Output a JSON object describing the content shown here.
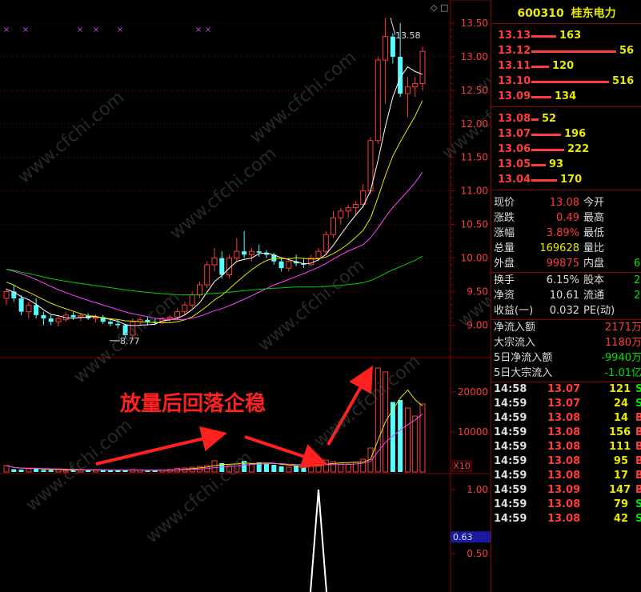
{
  "stock": {
    "code": "600310",
    "name": "桂东电力"
  },
  "price_axis": [
    "13.50",
    "13.00",
    "12.50",
    "12.00",
    "11.50",
    "11.00",
    "10.50",
    "10.00",
    "9.50",
    "9.00"
  ],
  "volume_axis": [
    "20000",
    "10000"
  ],
  "volume_unit": "X10",
  "indicator_axis": [
    "1.00",
    "0.50"
  ],
  "indicator_value": "0.63",
  "annotations": {
    "high": "13.58",
    "low": "8.77",
    "note": "放量后回落企稳"
  },
  "watermark": "www.cfchi.com",
  "order_book": {
    "asks": [
      {
        "price": "13.13",
        "vol": "163",
        "bar": 0.26
      },
      {
        "price": "13.12",
        "vol": "56",
        "bar": 0.9
      },
      {
        "price": "13.11",
        "vol": "120",
        "bar": 0.19
      },
      {
        "price": "13.10",
        "vol": "516",
        "bar": 0.82
      },
      {
        "price": "13.09",
        "vol": "134",
        "bar": 0.21
      }
    ],
    "bids": [
      {
        "price": "13.08",
        "vol": "52",
        "bar": 0.08
      },
      {
        "price": "13.07",
        "vol": "196",
        "bar": 0.31
      },
      {
        "price": "13.06",
        "vol": "222",
        "bar": 0.35
      },
      {
        "price": "13.05",
        "vol": "93",
        "bar": 0.15
      },
      {
        "price": "13.04",
        "vol": "170",
        "bar": 0.27
      }
    ]
  },
  "quote": {
    "rows": [
      {
        "l1": "现价",
        "v1": "13.08",
        "c1": "red",
        "l2": "今开",
        "v2": ""
      },
      {
        "l1": "涨跌",
        "v1": "0.49",
        "c1": "red",
        "l2": "最高",
        "v2": ""
      },
      {
        "l1": "涨幅",
        "v1": "3.89%",
        "c1": "red",
        "l2": "最低",
        "v2": ""
      },
      {
        "l1": "总量",
        "v1": "169628",
        "c1": "yellow",
        "l2": "量比",
        "v2": ""
      },
      {
        "l1": "外盘",
        "v1": "99875",
        "c1": "red",
        "l2": "内盘",
        "v2": "6"
      }
    ],
    "rows2": [
      {
        "l1": "换手",
        "v1": "6.15%",
        "c1": "white",
        "l2": "股本",
        "v2": "2"
      },
      {
        "l1": "净资",
        "v1": "10.61",
        "c1": "white",
        "l2": "流通",
        "v2": "2"
      },
      {
        "l1": "收益(一)",
        "v1": "0.032",
        "c1": "white",
        "l2": "PE(动)",
        "v2": ""
      }
    ],
    "flows": [
      {
        "label": "净流入额",
        "value": "2171万",
        "color": "red"
      },
      {
        "label": "大宗流入",
        "value": "1180万",
        "color": "red"
      },
      {
        "label": "5日净流入额",
        "value": "-9940万",
        "color": "green"
      },
      {
        "label": "5日大宗流入",
        "value": "-1.01亿",
        "color": "green"
      }
    ]
  },
  "trades": [
    {
      "time": "14:58",
      "price": "13.07",
      "vol": "121",
      "side": "S"
    },
    {
      "time": "14:59",
      "price": "13.07",
      "vol": "24",
      "side": "S"
    },
    {
      "time": "14:59",
      "price": "13.08",
      "vol": "14",
      "side": "B"
    },
    {
      "time": "14:59",
      "price": "13.08",
      "vol": "156",
      "side": "B"
    },
    {
      "time": "14:59",
      "price": "13.08",
      "vol": "111",
      "side": "B"
    },
    {
      "time": "14:59",
      "price": "13.08",
      "vol": "95",
      "side": "B"
    },
    {
      "time": "14:59",
      "price": "13.08",
      "vol": "17",
      "side": "B"
    },
    {
      "time": "14:59",
      "price": "13.09",
      "vol": "147",
      "side": "B"
    },
    {
      "time": "14:59",
      "price": "13.08",
      "vol": "79",
      "side": "S"
    },
    {
      "time": "14:59",
      "price": "13.08",
      "vol": "42",
      "side": "S"
    }
  ],
  "chart_data": {
    "type": "candlestick",
    "candles": [
      [
        9.4,
        9.55,
        9.3,
        9.5
      ],
      [
        9.5,
        9.6,
        9.35,
        9.4
      ],
      [
        9.4,
        9.45,
        9.15,
        9.2
      ],
      [
        9.2,
        9.35,
        9.1,
        9.3
      ],
      [
        9.3,
        9.4,
        9.1,
        9.15
      ],
      [
        9.15,
        9.2,
        9.0,
        9.1
      ],
      [
        9.1,
        9.15,
        9.0,
        9.05
      ],
      [
        9.05,
        9.15,
        8.98,
        9.1
      ],
      [
        9.08,
        9.2,
        9.05,
        9.15
      ],
      [
        9.15,
        9.2,
        9.08,
        9.12
      ],
      [
        9.12,
        9.18,
        9.06,
        9.14
      ],
      [
        9.14,
        9.18,
        9.08,
        9.1
      ],
      [
        9.1,
        9.16,
        9.04,
        9.12
      ],
      [
        9.12,
        9.15,
        9.02,
        9.05
      ],
      [
        9.05,
        9.1,
        8.98,
        9.02
      ],
      [
        9.02,
        9.08,
        8.95,
        9.0
      ],
      [
        9.0,
        9.02,
        8.8,
        8.85
      ],
      [
        8.85,
        9.1,
        8.77,
        9.05
      ],
      [
        9.05,
        9.12,
        9.0,
        9.08
      ],
      [
        9.08,
        9.12,
        9.0,
        9.05
      ],
      [
        9.05,
        9.1,
        9.0,
        9.04
      ],
      [
        9.04,
        9.12,
        9.02,
        9.1
      ],
      [
        9.1,
        9.15,
        9.05,
        9.12
      ],
      [
        9.12,
        9.25,
        9.08,
        9.2
      ],
      [
        9.2,
        9.35,
        9.15,
        9.3
      ],
      [
        9.3,
        9.5,
        9.25,
        9.45
      ],
      [
        9.45,
        9.65,
        9.4,
        9.6
      ],
      [
        9.6,
        9.95,
        9.55,
        9.9
      ],
      [
        9.9,
        10.15,
        9.8,
        10.0
      ],
      [
        10.0,
        10.1,
        9.7,
        9.75
      ],
      [
        9.75,
        10.05,
        9.7,
        10.0
      ],
      [
        10.0,
        10.3,
        9.95,
        10.1
      ],
      [
        10.1,
        10.4,
        10.0,
        10.05
      ],
      [
        10.05,
        10.15,
        9.95,
        10.1
      ],
      [
        10.1,
        10.2,
        10.02,
        10.08
      ],
      [
        10.08,
        10.12,
        10.0,
        10.05
      ],
      [
        10.05,
        10.08,
        9.9,
        9.95
      ],
      [
        9.95,
        10.0,
        9.8,
        9.85
      ],
      [
        9.85,
        10.0,
        9.8,
        9.95
      ],
      [
        9.95,
        10.05,
        9.88,
        9.92
      ],
      [
        9.92,
        10.0,
        9.85,
        9.9
      ],
      [
        9.9,
        10.05,
        9.88,
        10.0
      ],
      [
        10.0,
        10.15,
        9.95,
        10.1
      ],
      [
        10.1,
        10.4,
        10.05,
        10.35
      ],
      [
        10.35,
        10.7,
        10.3,
        10.6
      ],
      [
        10.6,
        10.75,
        10.5,
        10.7
      ],
      [
        10.7,
        10.8,
        10.6,
        10.75
      ],
      [
        10.75,
        10.85,
        10.65,
        10.8
      ],
      [
        10.8,
        11.1,
        10.75,
        11.0
      ],
      [
        11.0,
        11.8,
        10.95,
        11.75
      ],
      [
        11.75,
        13.0,
        11.7,
        12.95
      ],
      [
        12.95,
        13.58,
        12.3,
        13.3
      ],
      [
        13.3,
        13.35,
        12.9,
        13.0
      ],
      [
        13.0,
        13.5,
        12.4,
        12.45
      ],
      [
        12.45,
        12.7,
        12.1,
        12.55
      ],
      [
        12.55,
        12.7,
        12.4,
        12.6
      ],
      [
        12.6,
        13.15,
        12.5,
        13.08
      ]
    ],
    "volume": [
      1.6,
      0.7,
      0.6,
      0.8,
      0.9,
      0.5,
      0.5,
      0.6,
      0.4,
      0.5,
      0.6,
      0.4,
      0.5,
      0.6,
      0.4,
      0.4,
      0.5,
      0.6,
      0.5,
      0.3,
      0.4,
      0.5,
      0.6,
      0.9,
      1.0,
      1.2,
      1.4,
      1.6,
      2.8,
      2.2,
      1.6,
      2.0,
      2.8,
      2.0,
      2.4,
      2.0,
      1.8,
      1.4,
      1.2,
      1.5,
      1.4,
      1.6,
      2.0,
      3.0,
      2.6,
      2.2,
      2.0,
      2.4,
      3.2,
      6.0,
      26.0,
      25.0,
      17.5,
      18.0,
      16.0,
      14.0,
      17.0
    ],
    "price_range": [
      8.6,
      13.75
    ],
    "volume_range": [
      0,
      27000
    ]
  }
}
